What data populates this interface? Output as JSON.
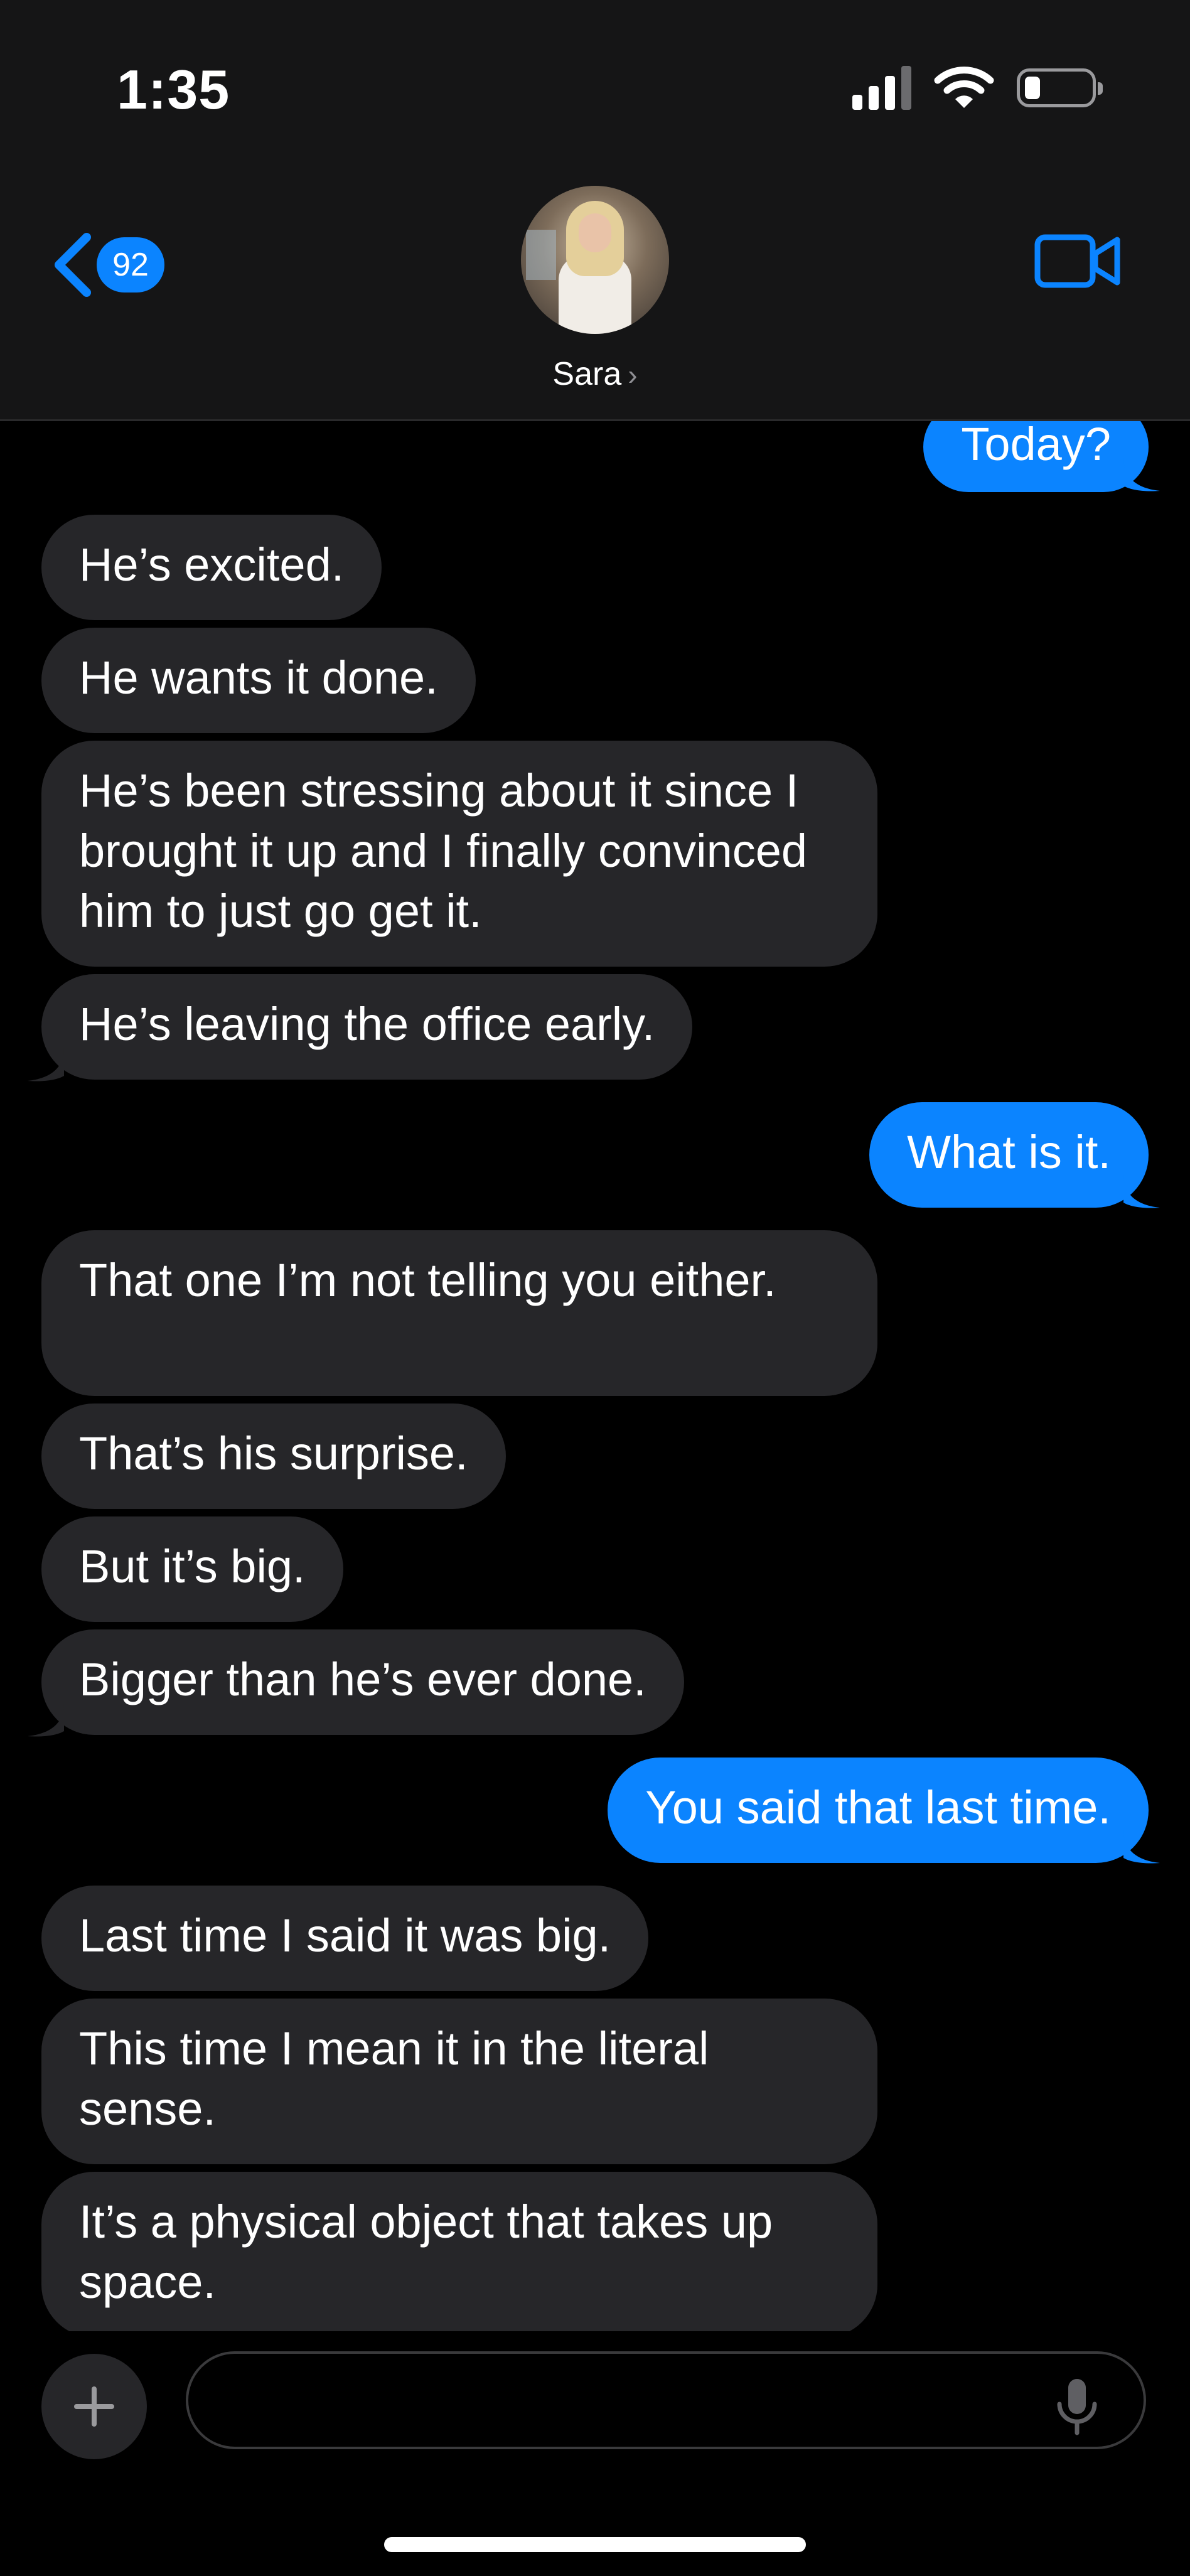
{
  "status_bar": {
    "time": "1:35",
    "icons": [
      "cellular-signal-icon",
      "wifi-icon",
      "battery-icon"
    ]
  },
  "header": {
    "unread_count": "92",
    "contact_name": "Sara",
    "contact_chevron": "›",
    "icons": [
      "chevron-left-icon",
      "video-camera-icon"
    ]
  },
  "theme": {
    "accent": "#0b84ff",
    "incoming_bubble": "#262629",
    "background": "#000000",
    "header_background": "#151516"
  },
  "messages": [
    {
      "from": "me",
      "text": "Today?"
    },
    {
      "from": "contact",
      "text": "He’s excited."
    },
    {
      "from": "contact",
      "text": "He wants it done."
    },
    {
      "from": "contact",
      "text": "He’s been stressing about it since I brought it up and I finally convinced him to just go get it."
    },
    {
      "from": "contact",
      "text": "He’s leaving the office early."
    },
    {
      "from": "me",
      "text": "What is it."
    },
    {
      "from": "contact",
      "text": "That one I’m not telling you either."
    },
    {
      "from": "contact",
      "text": "That’s his surprise."
    },
    {
      "from": "contact",
      "text": "But it’s big."
    },
    {
      "from": "contact",
      "text": "Bigger than he’s ever done."
    },
    {
      "from": "me",
      "text": "You said that last time."
    },
    {
      "from": "contact",
      "text": "Last time I said it was big."
    },
    {
      "from": "contact",
      "text": "This time I mean it in the literal sense."
    },
    {
      "from": "contact",
      "text": "It’s a physical object that takes up space."
    }
  ],
  "composer": {
    "plus_label": "+",
    "input_value": "",
    "icons": [
      "plus-icon",
      "microphone-icon"
    ]
  }
}
